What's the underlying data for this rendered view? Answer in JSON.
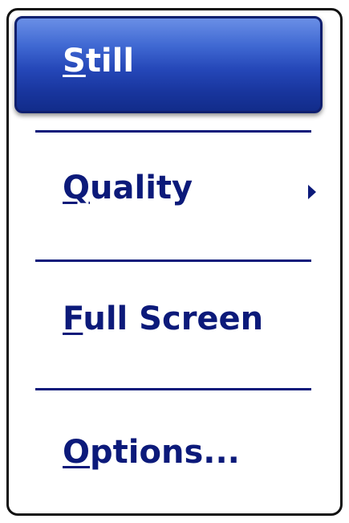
{
  "menu": {
    "items": [
      {
        "label_first": "S",
        "label_rest": "till",
        "selected": true,
        "has_submenu": false
      },
      {
        "label_first": "Q",
        "label_rest": "uality",
        "selected": false,
        "has_submenu": true
      },
      {
        "label_first": "F",
        "label_rest": "ull Screen",
        "selected": false,
        "has_submenu": false
      },
      {
        "label_first": "O",
        "label_rest": "ptions...",
        "selected": false,
        "has_submenu": false
      }
    ],
    "selected_color": "#2547b8",
    "text_color": "#0c1a7a",
    "icons": {
      "submenu_arrow": "triangle-right-icon"
    }
  }
}
